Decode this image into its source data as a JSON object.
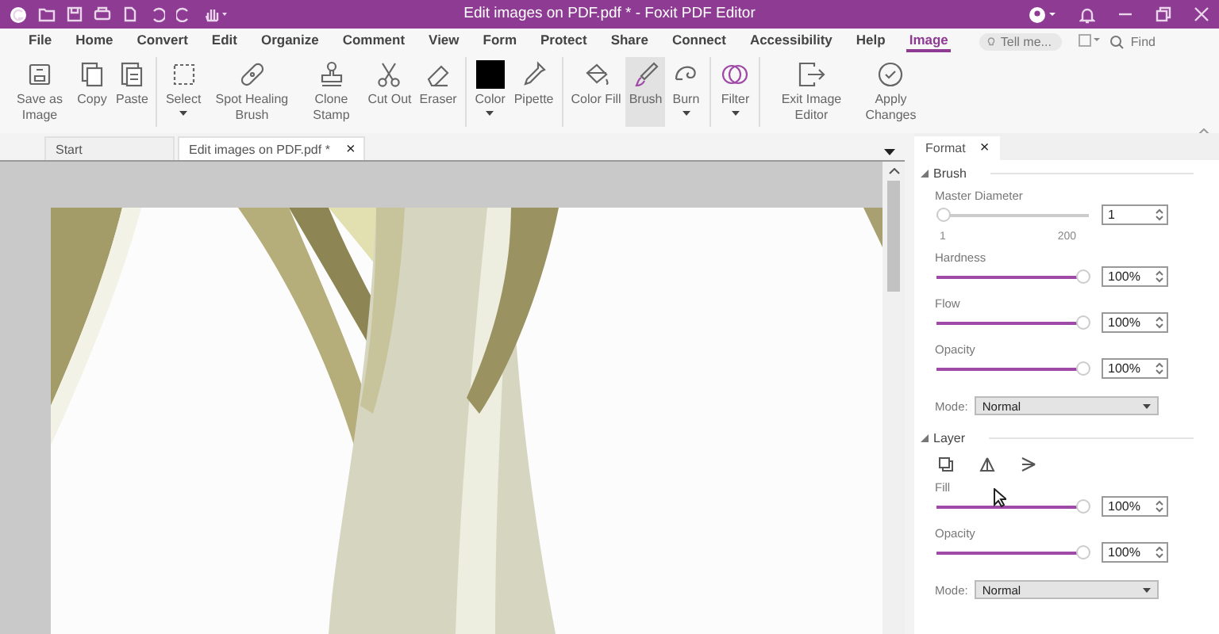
{
  "window": {
    "title": "Edit images on PDF.pdf * - Foxit PDF Editor"
  },
  "menu": [
    {
      "label": "File",
      "selected": false
    },
    {
      "label": "Home",
      "selected": false
    },
    {
      "label": "Convert",
      "selected": false
    },
    {
      "label": "Edit",
      "selected": false
    },
    {
      "label": "Organize",
      "selected": false
    },
    {
      "label": "Comment",
      "selected": false
    },
    {
      "label": "View",
      "selected": false
    },
    {
      "label": "Form",
      "selected": false
    },
    {
      "label": "Protect",
      "selected": false
    },
    {
      "label": "Share",
      "selected": false
    },
    {
      "label": "Connect",
      "selected": false
    },
    {
      "label": "Accessibility",
      "selected": false
    },
    {
      "label": "Help",
      "selected": false
    },
    {
      "label": "Image",
      "selected": true
    }
  ],
  "tell_me": {
    "placeholder": "Tell me..."
  },
  "find": {
    "placeholder": "Find"
  },
  "ribbon": [
    {
      "items": [
        {
          "label": "Save as Image",
          "selected": false,
          "dropdown": false
        },
        {
          "label": "Copy",
          "selected": false,
          "dropdown": false
        },
        {
          "label": "Paste",
          "selected": false,
          "dropdown": false
        }
      ]
    },
    {
      "items": [
        {
          "label": "Select",
          "selected": false,
          "dropdown": true
        },
        {
          "label": "Spot Healing Brush",
          "selected": false,
          "dropdown": false
        },
        {
          "label": "Clone Stamp",
          "selected": false,
          "dropdown": false
        },
        {
          "label": "Cut Out",
          "selected": false,
          "dropdown": false
        },
        {
          "label": "Eraser",
          "selected": false,
          "dropdown": false
        }
      ]
    },
    {
      "items": [
        {
          "label": "Color",
          "selected": false,
          "dropdown": true
        },
        {
          "label": "Pipette",
          "selected": false,
          "dropdown": false
        }
      ]
    },
    {
      "items": [
        {
          "label": "Color Fill",
          "selected": false,
          "dropdown": false
        },
        {
          "label": "Brush",
          "selected": true,
          "dropdown": false
        },
        {
          "label": "Burn",
          "selected": false,
          "dropdown": true
        }
      ]
    },
    {
      "items": [
        {
          "label": "Filter",
          "selected": false,
          "dropdown": true
        }
      ]
    },
    {
      "items": [
        {
          "label": "Exit Image Editor",
          "selected": false,
          "dropdown": false
        },
        {
          "label": "Apply Changes",
          "selected": false,
          "dropdown": false
        }
      ]
    }
  ],
  "tabs": [
    {
      "label": "Start",
      "selected": false
    },
    {
      "label": "Edit images on PDF.pdf *",
      "selected": true,
      "close": "×"
    }
  ],
  "panel": {
    "tab": "Format",
    "close": "×",
    "sections": [
      {
        "title": "Brush",
        "expanded": true,
        "controls": [
          {
            "kind": "slider",
            "label": "Master Diameter",
            "level": 0,
            "value": "1",
            "min": "1",
            "max": "200"
          },
          {
            "kind": "slider",
            "label": "Hardness",
            "level": 1,
            "value": "100%"
          },
          {
            "kind": "slider",
            "label": "Flow",
            "level": 1,
            "value": "100%"
          },
          {
            "kind": "slider",
            "label": "Opacity",
            "level": 1,
            "value": "100%"
          },
          {
            "kind": "select",
            "label": "Mode:",
            "value": "Normal"
          }
        ]
      },
      {
        "title": "Layer",
        "expanded": true,
        "controls": [
          {
            "kind": "tools"
          },
          {
            "kind": "slider",
            "label": "Fill",
            "level": 1,
            "value": "100%"
          },
          {
            "kind": "slider",
            "label": "Opacity",
            "level": 1,
            "value": "100%"
          },
          {
            "kind": "select",
            "label": "Mode:",
            "value": "Normal"
          }
        ]
      }
    ]
  }
}
